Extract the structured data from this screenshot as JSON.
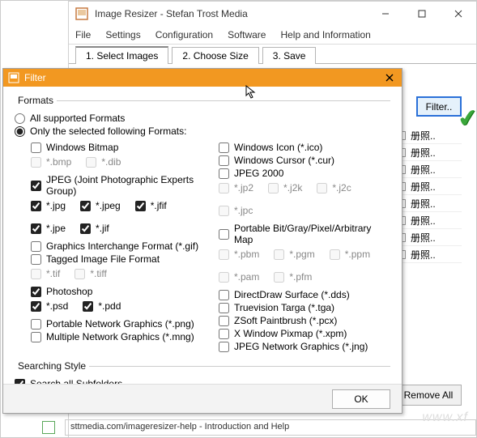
{
  "main_window": {
    "title": "Image Resizer - Stefan Trost Media",
    "menu": {
      "file": "File",
      "settings": "Settings",
      "configuration": "Configuration",
      "software": "Software",
      "help": "Help and Information"
    },
    "tabs": {
      "t1": "1. Select Images",
      "t2": "2. Choose Size",
      "t3": "3. Save"
    },
    "filter_button": "Filter..",
    "list_item_text": "册照..",
    "remove_all": "Remove All",
    "footer_text": "sttmedia.com/imageresizer-help - Introduction and Help",
    "watermark": "www.xf"
  },
  "dialog": {
    "title": "Filter",
    "formats_group": "Formats",
    "radio_all": "All supported Formats",
    "radio_sel": "Only the selected following Formats:",
    "opt_bitmap": "Windows Bitmap",
    "ext_bmp": "*.bmp",
    "ext_dib": "*.dib",
    "opt_jpeg": "JPEG (Joint Photographic Experts Group)",
    "ext_jpg": "*.jpg",
    "ext_jpe": "*.jpe",
    "ext_jpeg": "*.jpeg",
    "ext_jif": "*.jif",
    "ext_jfif": "*.jfif",
    "opt_gif": "Graphics Interchange Format (*.gif)",
    "opt_tiff": "Tagged Image File Format",
    "ext_tif": "*.tif",
    "ext_tiff": "*.tiff",
    "opt_psd": "Photoshop",
    "ext_psd": "*.psd",
    "ext_pdd": "*.pdd",
    "opt_png": "Portable Network Graphics (*.png)",
    "opt_mng": "Multiple Network Graphics (*.mng)",
    "opt_ico": "Windows Icon (*.ico)",
    "opt_cur": "Windows Cursor (*.cur)",
    "opt_jp2": "JPEG 2000",
    "ext_jp2": "*.jp2",
    "ext_jpc": "*.jpc",
    "ext_j2k": "*.j2k",
    "ext_j2c": "*.j2c",
    "opt_pbm": "Portable Bit/Gray/Pixel/Arbitrary Map",
    "ext_pbm": "*.pbm",
    "ext_pam": "*.pam",
    "ext_pgm": "*.pgm",
    "ext_pfm": "*.pfm",
    "ext_ppm": "*.ppm",
    "opt_dds": "DirectDraw Surface (*.dds)",
    "opt_tga": "Truevision Targa (*.tga)",
    "opt_pcx": "ZSoft Paintbrush (*.pcx)",
    "opt_xpm": "X Window Pixmap (*.xpm)",
    "opt_jng": "JPEG Network Graphics (*.jng)",
    "search_group": "Searching Style",
    "search_sub": "Search all Subfolders",
    "ok": "OK"
  }
}
